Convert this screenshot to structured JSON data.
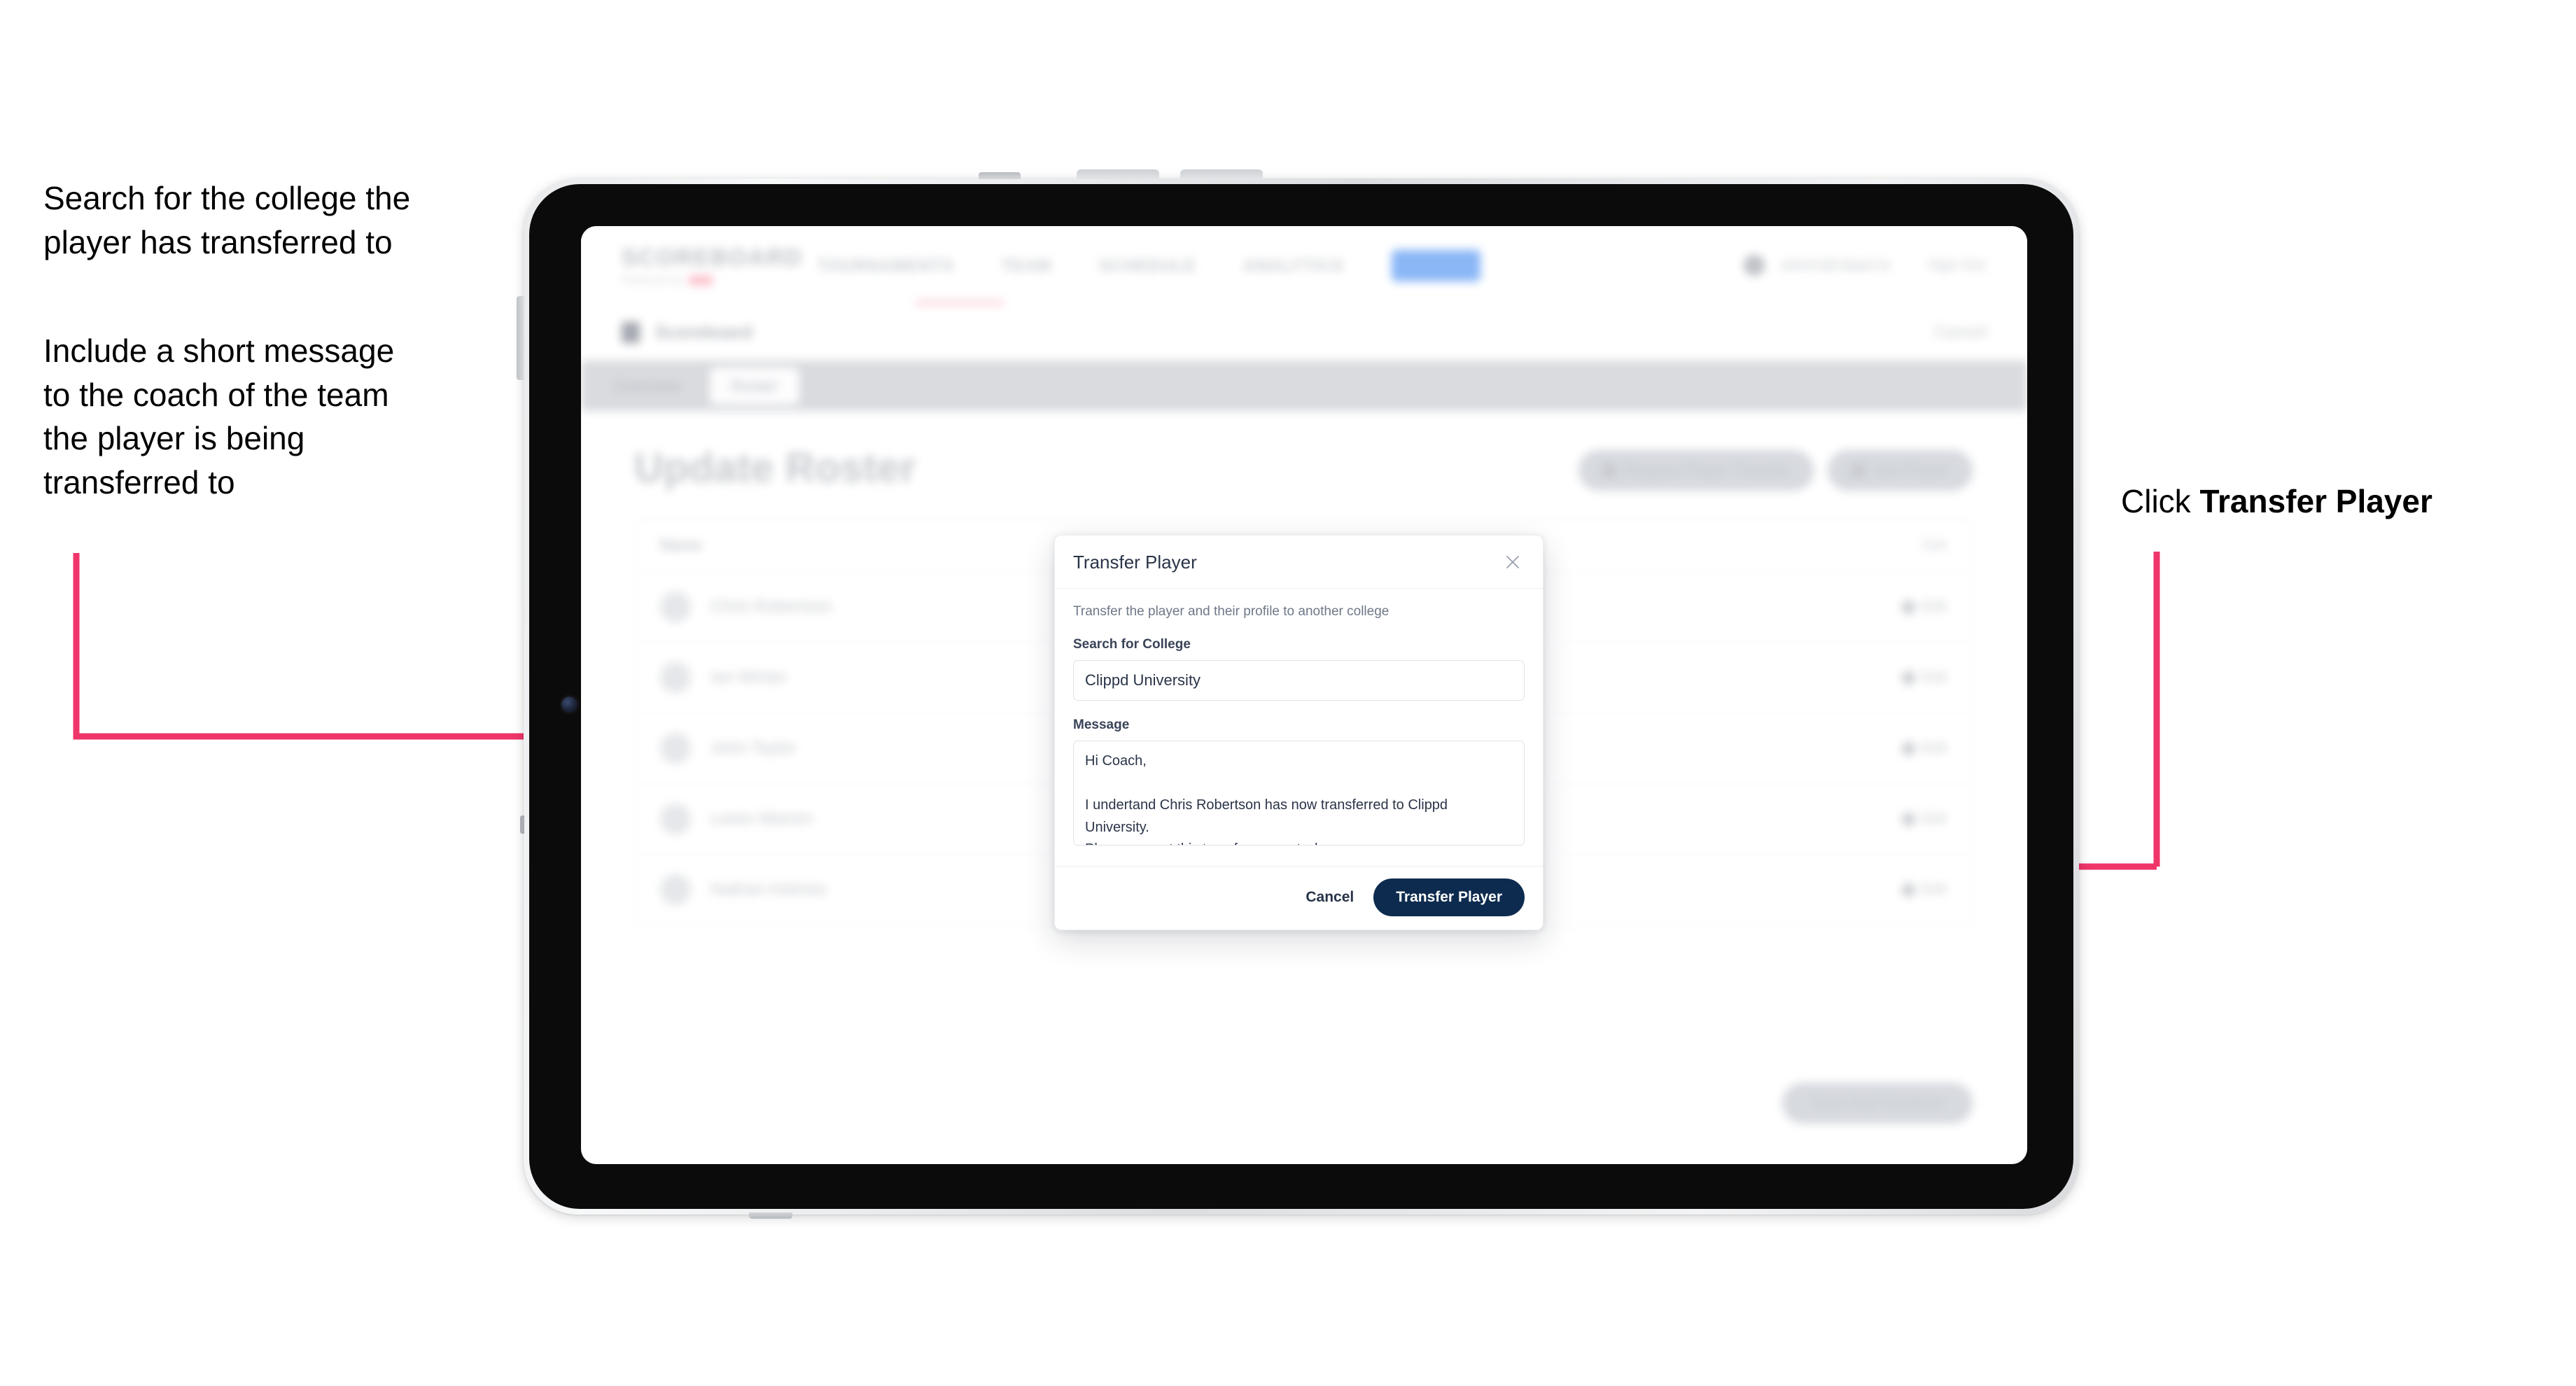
{
  "annotations": {
    "left_1": "Search for the college the\nplayer has transferred to",
    "left_2": "Include a short message\nto the coach of the team\nthe player is being\ntransferred to",
    "right_prefix": "Click ",
    "right_bold": "Transfer Player"
  },
  "colors": {
    "arrow_pink": "#ef356a",
    "primary_navy": "#0d2b4e",
    "nav_highlight_blue": "#7fb0f7",
    "brand_accent_pink": "#fbb7c4",
    "device_bezel": "#0b0b0b"
  },
  "app": {
    "nav": {
      "brand": "SCOREBOARD",
      "brand_sub": "Powered by",
      "brand_sub_badge": "Clippd",
      "items": [
        {
          "label": "TOURNAMENTS"
        },
        {
          "label": "TEAM"
        },
        {
          "label": "SCHEDULE"
        },
        {
          "label": "ANALYTICS"
        },
        {
          "label": "ADMIN",
          "highlighted": true
        }
      ],
      "account_email": "admin@clippd.io",
      "sign_out": "Sign Out"
    },
    "breadcrumb": {
      "icon": "shield-icon",
      "title": "Scoreboard",
      "subtitle": "Admin",
      "right_action": "Cancel"
    },
    "tabs": [
      {
        "label": "Overview",
        "active": false
      },
      {
        "label": "Roster",
        "active": true
      }
    ],
    "page": {
      "title": "Update Roster",
      "header_actions": [
        {
          "label": "Request Player Transfer",
          "icon": "transfer-icon"
        },
        {
          "label": "Add Player",
          "icon": "plus-icon"
        }
      ],
      "table": {
        "columns": [
          "Name",
          "Edit"
        ],
        "rows": [
          {
            "name": "Chris Robertson",
            "action": "Edit"
          },
          {
            "name": "Ian Winter",
            "action": "Edit"
          },
          {
            "name": "John Taylor",
            "action": "Edit"
          },
          {
            "name": "Lewis Warren",
            "action": "Edit"
          },
          {
            "name": "Nathan Holmes",
            "action": "Edit"
          }
        ]
      },
      "footer_action": "Save And Continue"
    }
  },
  "modal": {
    "title": "Transfer Player",
    "close_icon": "close-icon",
    "description": "Transfer the player and their profile to another college",
    "college_label": "Search for College",
    "college_value": "Clippd University",
    "college_placeholder": "Search for College",
    "message_label": "Message",
    "message_value": "Hi Coach,\n\nI undertand Chris Robertson has now transferred to Clippd University.\nPlease accept this transfer request when you can.",
    "message_placeholder": "Message",
    "cancel_label": "Cancel",
    "submit_label": "Transfer Player"
  }
}
